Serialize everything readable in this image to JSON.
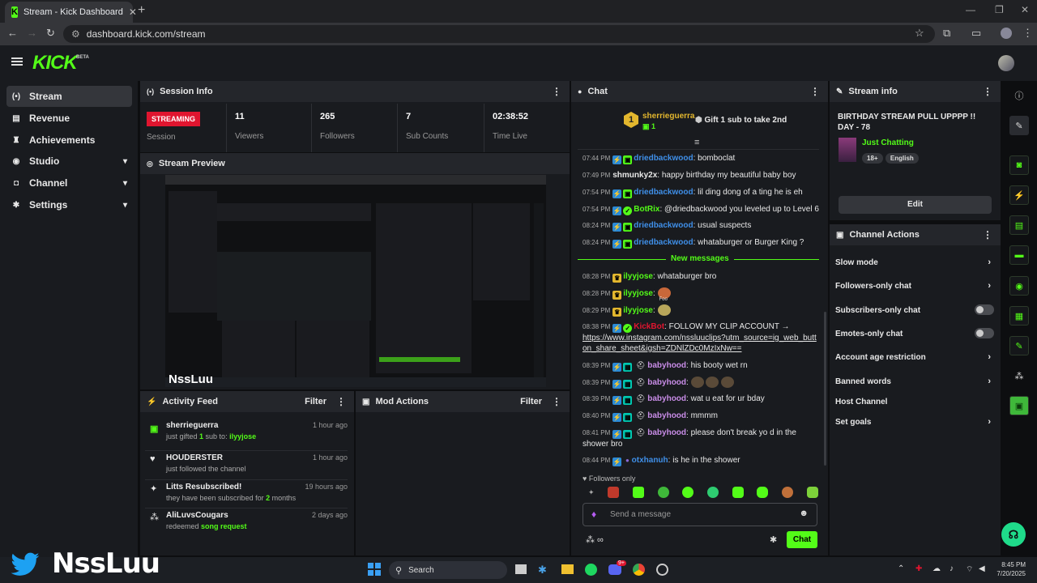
{
  "browser": {
    "tab_title": "Stream - Kick Dashboard",
    "url": "dashboard.kick.com/stream"
  },
  "app": {
    "logo": "KICK",
    "beta": "BETA"
  },
  "sidebar": {
    "items": [
      {
        "label": "Stream",
        "icon": "broadcast-icon",
        "active": true
      },
      {
        "label": "Revenue",
        "icon": "revenue-icon"
      },
      {
        "label": "Achievements",
        "icon": "trophy-icon"
      },
      {
        "label": "Studio",
        "icon": "studio-icon",
        "expandable": true
      },
      {
        "label": "Channel",
        "icon": "channel-icon",
        "expandable": true
      },
      {
        "label": "Settings",
        "icon": "gear-icon",
        "expandable": true
      }
    ]
  },
  "session": {
    "title": "Session Info",
    "status": "STREAMING",
    "status_label": "Session",
    "viewers": "11",
    "viewers_label": "Viewers",
    "followers": "265",
    "followers_label": "Followers",
    "subs": "7",
    "subs_label": "Sub Counts",
    "time": "02:38:52",
    "time_label": "Time Live"
  },
  "preview": {
    "title": "Stream Preview",
    "overlay_name": "NssLuu"
  },
  "activity": {
    "title": "Activity Feed",
    "filter": "Filter",
    "items": [
      {
        "name": "sherrieguerra",
        "desc_pre": "just gifted ",
        "desc_num": "1",
        "desc_mid": " sub to: ",
        "desc_user": "ilyyjose",
        "time": "1 hour ago"
      },
      {
        "name": "HOUDERSTER",
        "desc": "just followed the channel",
        "time": "1 hour ago"
      },
      {
        "name": "Litts Resubscribed!",
        "desc_pre": "they have been subscribed for ",
        "desc_num": "2",
        "desc_post": " months",
        "time": "19 hours ago"
      },
      {
        "name": "AliLuvsCougars",
        "desc_pre": "redeemed ",
        "desc_hl": "song request",
        "time": "2 days ago"
      }
    ]
  },
  "mod_actions": {
    "title": "Mod Actions",
    "filter": "Filter"
  },
  "chat": {
    "title": "Chat",
    "pinned_user": "sherrieguerra",
    "pinned_rank": "1",
    "pinned_count": "1",
    "pinned_text": "Gift 1 sub to take 2nd",
    "new_messages": "New messages",
    "followers_only": "Followers only",
    "placeholder": "Send a message",
    "send": "Chat",
    "messages": [
      {
        "time": "07:44 PM",
        "user": "driedbackwood",
        "color": "#3f8fe8",
        "text": "bomboclat",
        "badges": [
          "vip",
          "sub"
        ]
      },
      {
        "time": "07:49 PM",
        "user": "shmunky2x",
        "color": "#e8e8e8",
        "text": "happy birthday my beautiful baby boy",
        "badges": []
      },
      {
        "time": "07:54 PM",
        "user": "driedbackwood",
        "color": "#3f8fe8",
        "text": "lil ding dong of a ting he is eh",
        "badges": [
          "vip",
          "sub"
        ]
      },
      {
        "time": "07:54 PM",
        "user": "BotRix",
        "color": "#53fc18",
        "text": "@driedbackwood you leveled up to Level 6",
        "badges": [
          "vip",
          "verified"
        ]
      },
      {
        "time": "08:24 PM",
        "user": "driedbackwood",
        "color": "#3f8fe8",
        "text": "usual suspects",
        "badges": [
          "vip",
          "sub"
        ]
      },
      {
        "time": "08:24 PM",
        "user": "driedbackwood",
        "color": "#3f8fe8",
        "text": "whataburger or Burger King ?",
        "badges": [
          "vip",
          "sub"
        ]
      },
      {
        "time": "08:28 PM",
        "user": "ilyyjose",
        "color": "#53fc18",
        "text": "whataburger bro",
        "badges": [
          "crown"
        ]
      },
      {
        "time": "08:28 PM",
        "user": "ilyyjose",
        "color": "#53fc18",
        "text": "",
        "emote": "Foo",
        "badges": [
          "crown"
        ]
      },
      {
        "time": "08:29 PM",
        "user": "ilyyjose",
        "color": "#53fc18",
        "text": "",
        "badges": [
          "crown"
        ]
      },
      {
        "time": "08:38 PM",
        "user": "KickBot",
        "color": "#e0152f",
        "text": "FOLLOW MY CLIP ACCOUNT →",
        "link": "https://www.instagram.com/nssluuclips?utm_source=ig_web_button_share_sheet&igsh=ZDNlZDc0MzIxNw==",
        "badges": [
          "vip",
          "verified"
        ]
      },
      {
        "time": "08:39 PM",
        "user": "babyhood",
        "color": "#c98de8",
        "text": "his booty wet rn",
        "badges": [
          "vip",
          "mod",
          "hat"
        ]
      },
      {
        "time": "08:39 PM",
        "user": "babyhood",
        "color": "#c98de8",
        "text": "",
        "badges": [
          "vip",
          "mod",
          "hat"
        ]
      },
      {
        "time": "08:39 PM",
        "user": "babyhood",
        "color": "#c98de8",
        "text": "wat u eat for ur bday",
        "badges": [
          "vip",
          "mod",
          "hat"
        ]
      },
      {
        "time": "08:40 PM",
        "user": "babyhood",
        "color": "#c98de8",
        "text": "mmmm",
        "badges": [
          "vip",
          "mod",
          "hat"
        ]
      },
      {
        "time": "08:41 PM",
        "user": "babyhood",
        "color": "#c98de8",
        "text": "please don't break yo d in the shower bro",
        "badges": [
          "vip",
          "mod",
          "hat"
        ]
      },
      {
        "time": "08:44 PM",
        "user": "otxhanuh",
        "color": "#3f8fe8",
        "text": "is he in the shower",
        "badges": [
          "vip",
          "dot"
        ]
      }
    ]
  },
  "stream_info": {
    "title": "Stream info",
    "stream_title": "BIRTHDAY STREAM PULL UPPPP !! DAY - 78",
    "category": "Just Chatting",
    "tags": [
      "18+",
      "English"
    ],
    "edit": "Edit"
  },
  "channel_actions": {
    "title": "Channel Actions",
    "items": [
      {
        "label": "Slow mode",
        "control": "chevron"
      },
      {
        "label": "Followers-only chat",
        "control": "chevron"
      },
      {
        "label": "Subscribers-only chat",
        "control": "toggle"
      },
      {
        "label": "Emotes-only chat",
        "control": "toggle"
      },
      {
        "label": "Account age restriction",
        "control": "chevron"
      },
      {
        "label": "Banned words",
        "control": "chevron"
      },
      {
        "label": "Host Channel",
        "control": "none"
      },
      {
        "label": "Set goals",
        "control": "chevron"
      }
    ]
  },
  "taskbar": {
    "search": "Search",
    "time": "8:45 PM",
    "date": "7/20/2025",
    "spotify_badge": "9+"
  },
  "watermark": "NssLuu",
  "colors": {
    "kick_green": "#53fc18",
    "streaming_red": "#e0152f"
  }
}
